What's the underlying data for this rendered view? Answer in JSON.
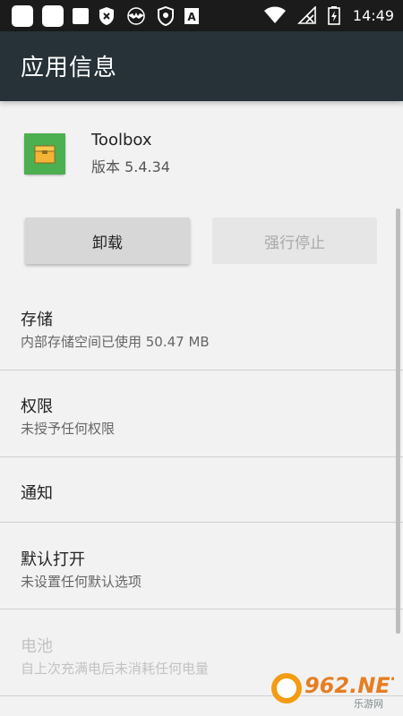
{
  "status_bar": {
    "time": "14:49",
    "icons": [
      "square-icon",
      "square-icon",
      "square-icon",
      "shield-x-icon",
      "bat-icon",
      "shield-icon",
      "a-icon",
      "wifi-icon",
      "no-sim-icon",
      "battery-charging-icon"
    ]
  },
  "app_bar": {
    "title": "应用信息"
  },
  "app": {
    "name": "Toolbox",
    "version": "版本 5.4.34",
    "icon_color": "#4caf50"
  },
  "buttons": {
    "uninstall": "卸载",
    "force_stop": "强行停止"
  },
  "sections": {
    "storage": {
      "title": "存储",
      "subtitle": "内部存储空间已使用 50.47 MB"
    },
    "permissions": {
      "title": "权限",
      "subtitle": "未授予任何权限"
    },
    "notifications": {
      "title": "通知"
    },
    "open_by_default": {
      "title": "默认打开",
      "subtitle": "未设置任何默认选项"
    },
    "battery": {
      "title": "电池",
      "subtitle": "自上次充满电后未消耗任何电量"
    }
  },
  "watermark": {
    "brand": "962.NET",
    "sub": "乐游网"
  }
}
